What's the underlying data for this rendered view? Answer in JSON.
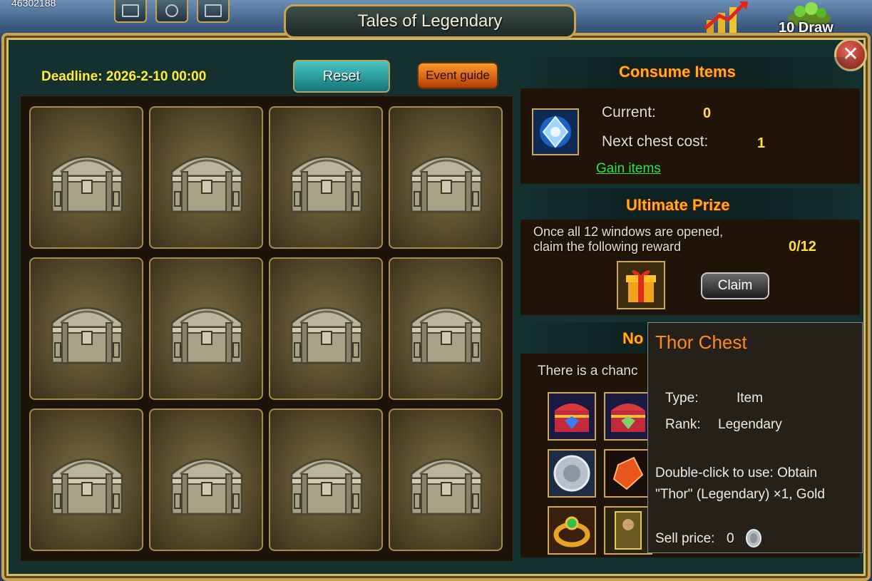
{
  "hud": {
    "score": "46302188",
    "draw_label": "10 Draw"
  },
  "window": {
    "title": "Tales of Legendary",
    "close_label": "✕",
    "deadline": "Deadline: 2026-2-10 00:00",
    "reset_label": "Reset",
    "event_guide_label": "Event guide"
  },
  "chests": {
    "count": 12,
    "state": "closed"
  },
  "consume": {
    "title": "Consume Items",
    "current_label": "Current:",
    "current_value": "0",
    "next_cost_label": "Next chest cost:",
    "next_cost_value": "1",
    "gain_link": "Gain items"
  },
  "ultimate": {
    "title": "Ultimate Prize",
    "desc_line1": "Once all 12 windows are opened,",
    "desc_line2": "claim the following reward",
    "progress": "0/12",
    "claim_label": "Claim"
  },
  "normal": {
    "title_visible": "No",
    "desc_visible": "There is a chanc"
  },
  "tooltip": {
    "title": "Thor Chest",
    "type_label": "Type:",
    "type_value": "Item",
    "rank_label": "Rank:",
    "rank_value": "Legendary",
    "use_line1": "Double-click to use: Obtain",
    "use_line2": "\"Thor\" (Legendary) ×1, Gold",
    "sell_label": "Sell price:",
    "sell_value": "0"
  },
  "colors": {
    "accent_gold": "#c8a452",
    "section_title": "#ffae1a",
    "value_yellow": "#ffe03b",
    "link_green": "#33e04b",
    "tooltip_title": "#ff8c1a"
  }
}
